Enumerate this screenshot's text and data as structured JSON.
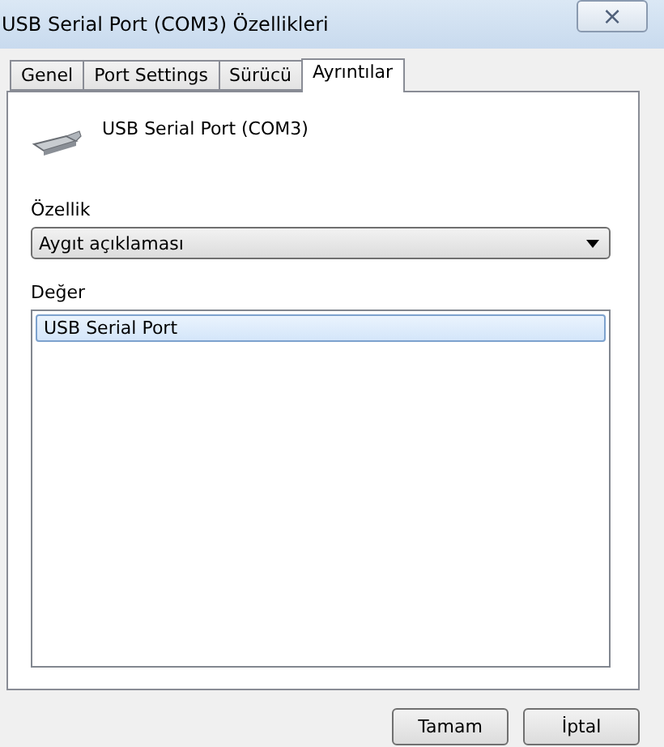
{
  "window": {
    "title": "USB Serial Port (COM3) Özellikleri",
    "close": "×"
  },
  "tabs": [
    {
      "label": "Genel",
      "selected": false
    },
    {
      "label": "Port Settings",
      "selected": false
    },
    {
      "label": "Sürücü",
      "selected": false
    },
    {
      "label": "Ayrıntılar",
      "selected": true
    }
  ],
  "device": {
    "name": "USB Serial Port (COM3)"
  },
  "property": {
    "label": "Özellik",
    "value": "Aygıt açıklaması"
  },
  "value": {
    "label": "Değer",
    "items": [
      {
        "text": "USB Serial Port",
        "selected": true
      }
    ]
  },
  "buttons": [
    "Tamam",
    "İptal"
  ]
}
